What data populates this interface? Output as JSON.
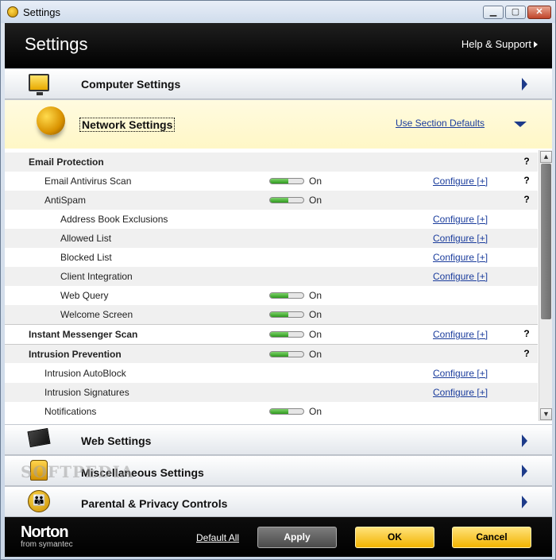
{
  "window": {
    "title": "Settings",
    "min": "▁",
    "max": "▢",
    "close": "✕"
  },
  "header": {
    "title": "Settings",
    "help": "Help & Support"
  },
  "sections": {
    "computer": "Computer Settings",
    "network": "Network Settings",
    "network_defaults": "Use Section Defaults",
    "web": "Web Settings",
    "misc": "Miscellaneous Settings",
    "parental": "Parental & Privacy Controls"
  },
  "rows": [
    {
      "label": "Email Protection",
      "level": 0,
      "toggle": false,
      "on": "",
      "configure": "",
      "help": "?"
    },
    {
      "label": "Email Antivirus Scan",
      "level": 1,
      "toggle": true,
      "on": "On",
      "configure": "Configure [+]",
      "help": "?"
    },
    {
      "label": "AntiSpam",
      "level": 1,
      "toggle": true,
      "on": "On",
      "configure": "",
      "help": "?"
    },
    {
      "label": "Address Book Exclusions",
      "level": 2,
      "toggle": false,
      "on": "",
      "configure": "Configure [+]",
      "help": ""
    },
    {
      "label": "Allowed List",
      "level": 2,
      "toggle": false,
      "on": "",
      "configure": "Configure [+]",
      "help": ""
    },
    {
      "label": "Blocked List",
      "level": 2,
      "toggle": false,
      "on": "",
      "configure": "Configure [+]",
      "help": ""
    },
    {
      "label": "Client Integration",
      "level": 2,
      "toggle": false,
      "on": "",
      "configure": "Configure [+]",
      "help": ""
    },
    {
      "label": "Web Query",
      "level": 2,
      "toggle": true,
      "on": "On",
      "configure": "",
      "help": ""
    },
    {
      "label": "Welcome Screen",
      "level": 2,
      "toggle": true,
      "on": "On",
      "configure": "",
      "help": ""
    },
    {
      "label": "Instant Messenger Scan",
      "level": 0,
      "toggle": true,
      "on": "On",
      "configure": "Configure [+]",
      "help": "?"
    },
    {
      "label": "Intrusion Prevention",
      "level": 0,
      "toggle": true,
      "on": "On",
      "configure": "",
      "help": "?"
    },
    {
      "label": "Intrusion AutoBlock",
      "level": 1,
      "toggle": false,
      "on": "",
      "configure": "Configure [+]",
      "help": ""
    },
    {
      "label": "Intrusion Signatures",
      "level": 1,
      "toggle": false,
      "on": "",
      "configure": "Configure [+]",
      "help": ""
    },
    {
      "label": "Notifications",
      "level": 1,
      "toggle": true,
      "on": "On",
      "configure": "",
      "help": ""
    }
  ],
  "toggle_level": 0.55,
  "footer": {
    "brand": "Norton",
    "brand_sub": "from symantec",
    "default_all": "Default All",
    "apply": "Apply",
    "ok": "OK",
    "cancel": "Cancel"
  },
  "watermark": "SOFTPEDIA"
}
